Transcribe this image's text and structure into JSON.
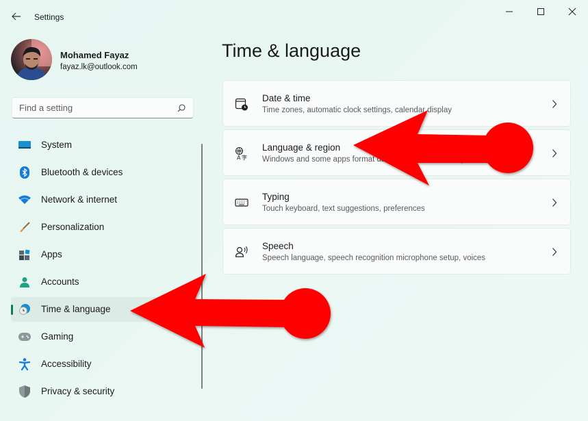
{
  "window": {
    "title": "Settings",
    "controls": {
      "minimize": "minimize",
      "maximize": "maximize",
      "close": "close"
    }
  },
  "profile": {
    "name": "Mohamed Fayaz",
    "email": "fayaz.lk@outlook.com"
  },
  "search": {
    "placeholder": "Find a setting",
    "value": ""
  },
  "sidebar": {
    "items": [
      {
        "label": "System",
        "icon": "monitor-icon",
        "active": false
      },
      {
        "label": "Bluetooth & devices",
        "icon": "bluetooth-icon",
        "active": false
      },
      {
        "label": "Network & internet",
        "icon": "wifi-icon",
        "active": false
      },
      {
        "label": "Personalization",
        "icon": "brush-icon",
        "active": false
      },
      {
        "label": "Apps",
        "icon": "apps-icon",
        "active": false
      },
      {
        "label": "Accounts",
        "icon": "person-icon",
        "active": false
      },
      {
        "label": "Time & language",
        "icon": "globe-clock-icon",
        "active": true
      },
      {
        "label": "Gaming",
        "icon": "gamepad-icon",
        "active": false
      },
      {
        "label": "Accessibility",
        "icon": "accessibility-icon",
        "active": false
      },
      {
        "label": "Privacy & security",
        "icon": "shield-icon",
        "active": false
      }
    ]
  },
  "main": {
    "title": "Time & language",
    "cards": [
      {
        "title": "Date & time",
        "description": "Time zones, automatic clock settings, calendar display",
        "icon": "calendar-clock-icon"
      },
      {
        "title": "Language & region",
        "description": "Windows and some apps format date and time based on your region",
        "icon": "language-icon"
      },
      {
        "title": "Typing",
        "description": "Touch keyboard, text suggestions, preferences",
        "icon": "keyboard-icon"
      },
      {
        "title": "Speech",
        "description": "Speech language, speech recognition microphone setup, voices",
        "icon": "speech-icon"
      }
    ]
  },
  "annotations": {
    "arrow_color": "#ff0000",
    "targets": [
      "Time & language",
      "Language & region"
    ]
  }
}
